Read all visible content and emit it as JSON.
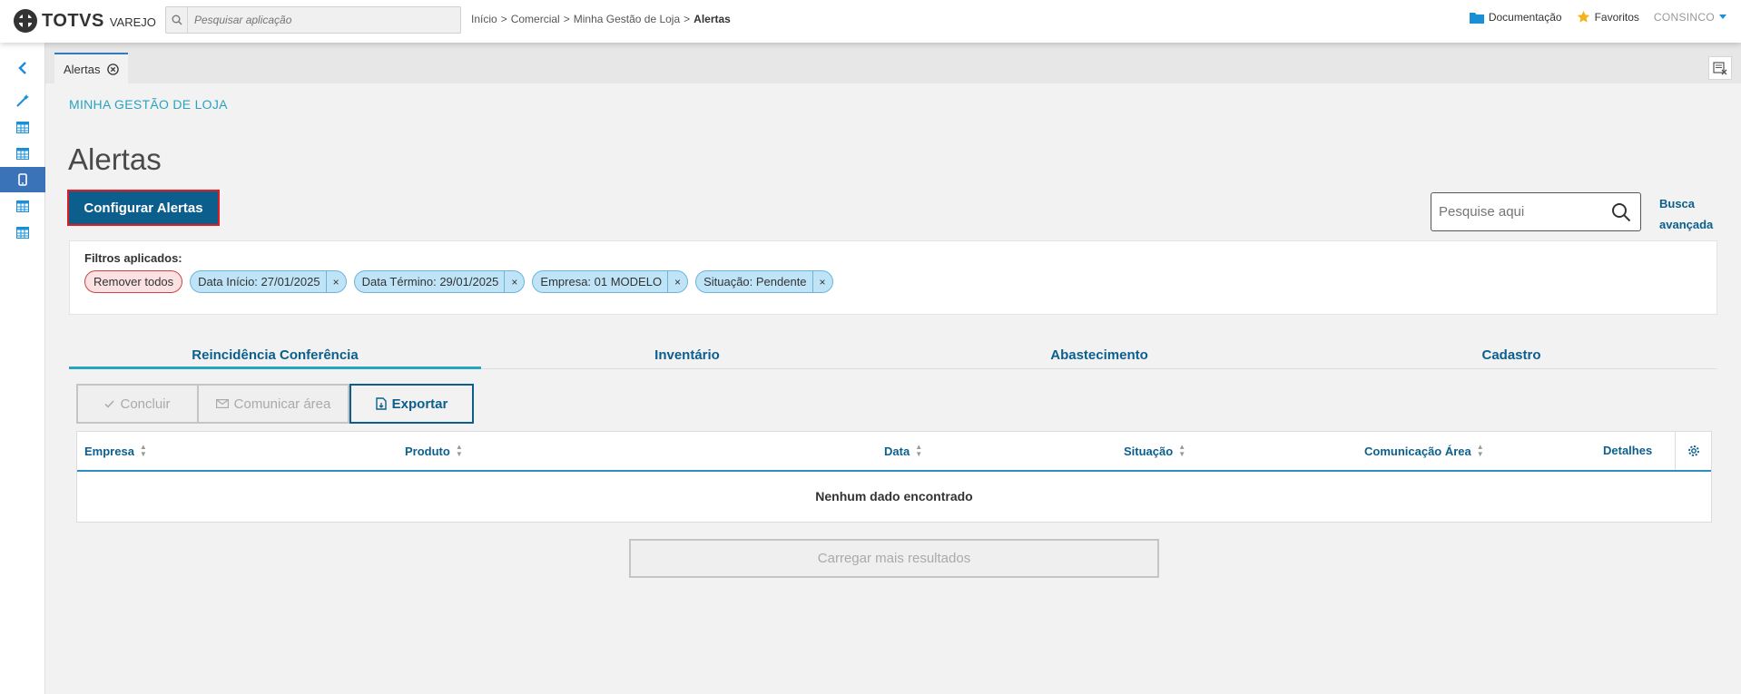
{
  "header": {
    "logo_text": "TOTVS",
    "logo_sub": "VAREJO",
    "search_placeholder": "Pesquisar aplicação",
    "breadcrumb": [
      "Início",
      "Comercial",
      "Minha Gestão de Loja",
      "Alertas"
    ],
    "breadcrumb_sep": ">",
    "documentation_label": "Documentação",
    "favorites_label": "Favoritos",
    "user_label": "CONSINCO"
  },
  "sidebar": {
    "items": [
      {
        "icon": "chevron-left-icon"
      },
      {
        "icon": "magic-wand-icon"
      },
      {
        "icon": "table-icon"
      },
      {
        "icon": "table-icon"
      },
      {
        "icon": "mobile-icon",
        "active": true
      },
      {
        "icon": "table-icon"
      },
      {
        "icon": "table-icon"
      }
    ]
  },
  "tabs": {
    "open_tab_label": "Alertas"
  },
  "page": {
    "module_title": "MINHA GESTÃO DE LOJA",
    "title": "Alertas",
    "config_button": "Configurar Alertas",
    "search_placeholder": "Pesquise aqui",
    "advanced_search": "Busca avançada"
  },
  "filters": {
    "label": "Filtros aplicados:",
    "remove_all": "Remover todos",
    "chips": [
      "Data Início: 27/01/2025",
      "Data Término: 29/01/2025",
      "Empresa: 01 MODELO",
      "Situação: Pendente"
    ],
    "chip_close": "×"
  },
  "subtabs": [
    "Reincidência Conferência",
    "Inventário",
    "Abastecimento",
    "Cadastro"
  ],
  "actions": {
    "concluir": "Concluir",
    "comunicar": "Comunicar área",
    "exportar": "Exportar"
  },
  "table": {
    "columns": [
      "Empresa",
      "Produto",
      "Data",
      "Situação",
      "Comunicação Área",
      "Detalhes"
    ],
    "empty_message": "Nenhum dado encontrado"
  },
  "load_more": "Carregar mais resultados",
  "colors": {
    "primary": "#0c5f8c",
    "accent": "#29a3bf",
    "highlight_border": "#e21a22",
    "chip_bg": "#bfe4f7",
    "remove_chip_bg": "#fbe1e1"
  }
}
